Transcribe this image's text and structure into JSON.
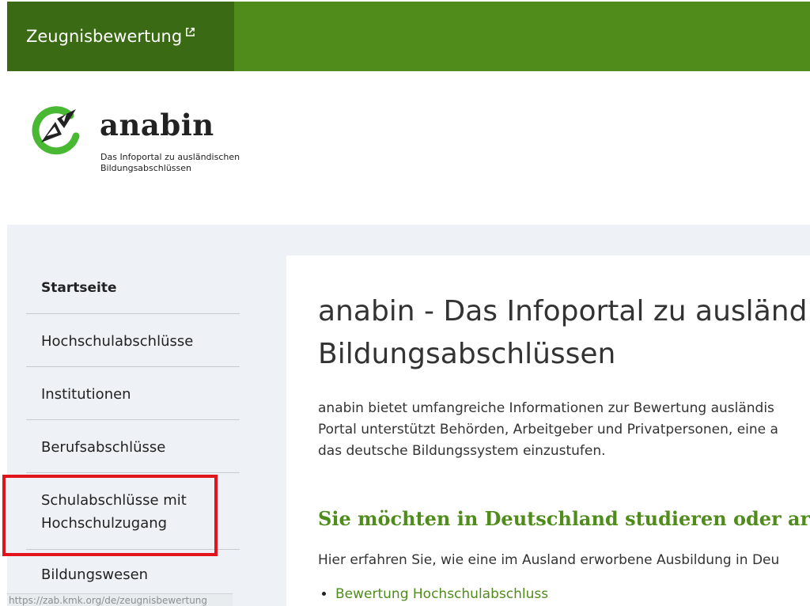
{
  "header": {
    "tab_label": "Zeugnisbewertung",
    "tab_icon": "external-link-icon",
    "colors": {
      "bar": "#4f8c1b",
      "tab": "#3a6b14"
    }
  },
  "logo": {
    "wordmark": "anabin",
    "tagline_line1": "Das Infoportal zu ausländischen",
    "tagline_line2": "Bildungsabschlüssen",
    "icon": "compass-logo-icon"
  },
  "sidebar": {
    "items": [
      {
        "label": "Startseite"
      },
      {
        "label": "Hochschulabschlüsse"
      },
      {
        "label": "Institutionen"
      },
      {
        "label": "Berufsabschlüsse"
      },
      {
        "label": "Schulabschlüsse mit",
        "label2": "Hochschulzugang"
      },
      {
        "label": "Bildungswesen"
      }
    ]
  },
  "status_bar": {
    "url": "https://zab.kmk.org/de/zeugnisbewertung"
  },
  "main": {
    "title_line1": "anabin - Das Infoportal zu ausländ",
    "title_line2": "Bildungsabschlüssen",
    "intro_line1": "anabin bietet umfangreiche Informationen zur Bewertung ausländis",
    "intro_line2": "Portal unterstützt Behörden, Arbeitgeber und Privatpersonen, eine a",
    "intro_line3": "das deutsche Bildungssystem einzustufen.",
    "section_heading": "Sie möchten in Deutschland studieren oder arbe",
    "section_text": "Hier erfahren Sie, wie eine im Ausland erworbene Ausbildung in Deu",
    "links": [
      {
        "label": "Bewertung Hochschulabschluss"
      }
    ],
    "colors": {
      "accent": "#4f8c1b",
      "highlight": "#e3131b"
    }
  }
}
